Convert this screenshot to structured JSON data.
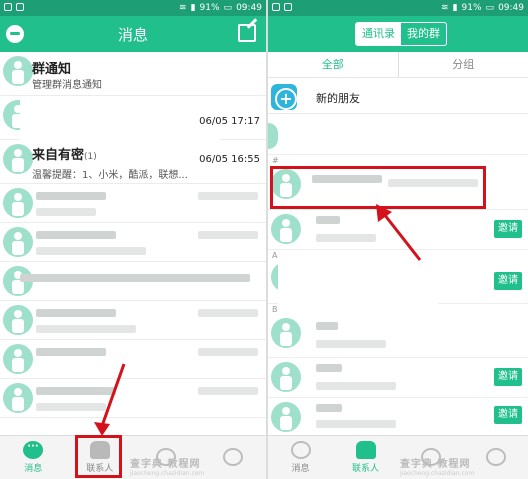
{
  "status": {
    "battery": "91%",
    "time": "09:49"
  },
  "left": {
    "title": "消息",
    "rows": [
      {
        "name": "群通知",
        "sub": "管理群消息通知",
        "time": ""
      },
      {
        "name": "",
        "sub": "",
        "time": "06/05 17:17"
      },
      {
        "name": "来自有密",
        "badge": "(1)",
        "sub": "温馨提醒：1、小米，酷派，联想...",
        "time": "06/05 16:55"
      }
    ],
    "nav": {
      "messages": "消息",
      "contacts": "联系人"
    }
  },
  "right": {
    "tabs": {
      "contacts": "通讯录",
      "groups": "我的群"
    },
    "subtabs": {
      "all": "全部",
      "grouped": "分组"
    },
    "new_friends": "新的朋友",
    "letters": [
      "#",
      "A",
      "B"
    ],
    "invite_label": "邀请",
    "nav": {
      "messages": "消息",
      "contacts": "联系人"
    }
  },
  "watermark": {
    "text": "查字典 教程网",
    "url": "jiaocheng.chazidian.com"
  },
  "colors": {
    "brand_green": "#21bf8c",
    "annotation_red": "#d4121b"
  }
}
